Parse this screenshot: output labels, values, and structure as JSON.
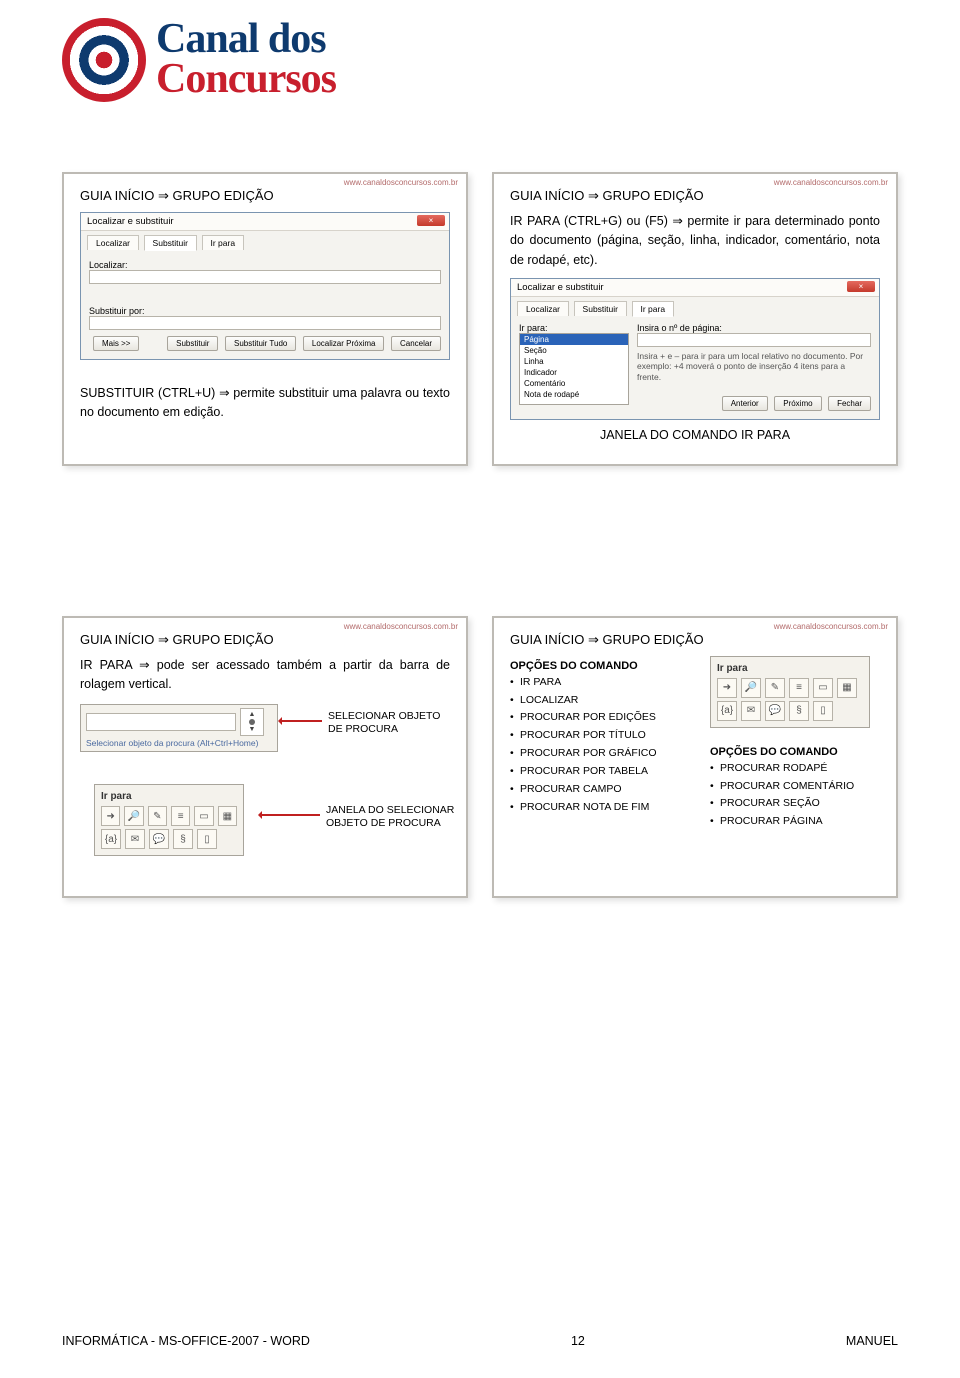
{
  "logo": {
    "line1": "Canal dos",
    "line2": "Concursos"
  },
  "watermark": "www.canaldosconcursos.com.br",
  "row1": {
    "left": {
      "title": "GUIA INÍCIO ⇒ GRUPO EDIÇÃO",
      "dialog": {
        "title": "Localizar e substituir",
        "tabs": [
          "Localizar",
          "Substituir",
          "Ir para"
        ],
        "label_find": "Localizar:",
        "label_replace": "Substituir por:",
        "buttons": [
          "Mais >>",
          "Substituir",
          "Substituir Tudo",
          "Localizar Próxima",
          "Cancelar"
        ]
      },
      "body_text": "SUBSTITUIR (CTRL+U) ⇒ permite substituir uma palavra ou texto no documento em edição."
    },
    "right": {
      "title": "GUIA INÍCIO ⇒ GRUPO EDIÇÃO",
      "body_text": "IR PARA (CTRL+G) ou (F5) ⇒ permite ir para determinado ponto do documento (página, seção, linha, indicador, comentário, nota de rodapé, etc).",
      "dialog": {
        "title": "Localizar e substituir",
        "tabs": [
          "Localizar",
          "Substituir",
          "Ir para"
        ],
        "label_goto": "Ir para:",
        "label_pagenum": "Insira o nº de página:",
        "list": [
          "Página",
          "Seção",
          "Linha",
          "Indicador",
          "Comentário",
          "Nota de rodapé"
        ],
        "note": "Insira + e – para ir para um local relativo no documento. Por exemplo: +4 moverá o ponto de inserção 4 itens para a frente.",
        "buttons": [
          "Anterior",
          "Próximo",
          "Fechar"
        ]
      },
      "caption": "JANELA DO COMANDO IR PARA"
    }
  },
  "row2": {
    "left": {
      "title": "GUIA INÍCIO ⇒ GRUPO EDIÇÃO",
      "body_text": "IR PARA ⇒ pode ser acessado também a partir da barra de rolagem vertical.",
      "chooser_label": "Selecionar objeto da procura (Alt+Ctrl+Home)",
      "toolbar_title": "Ir para",
      "cap1": "SELECIONAR OBJETO\nDE PROCURA",
      "cap2": "JANELA DO SELECIONAR\nOBJETO DE PROCURA"
    },
    "right": {
      "title": "GUIA INÍCIO ⇒ GRUPO EDIÇÃO",
      "opts_title_left": "OPÇÕES  DO COMANDO",
      "opts_left": [
        "IR PARA",
        "LOCALIZAR",
        "PROCURAR POR EDIÇÕES",
        "PROCURAR POR TÍTULO",
        "PROCURAR POR GRÁFICO",
        "PROCURAR POR TABELA",
        "PROCURAR CAMPO",
        "PROCURAR NOTA DE FIM"
      ],
      "toolbar_title": "Ir para",
      "opts_title_right": "OPÇÕES  DO COMANDO",
      "opts_right": [
        "PROCURAR RODAPÉ",
        "PROCURAR COMENTÁRIO",
        "PROCURAR SEÇÃO",
        "PROCURAR PÁGINA"
      ]
    }
  },
  "footer": {
    "left": "INFORMÁTICA - MS-OFFICE-2007 - WORD",
    "center": "12",
    "right": "MANUEL"
  }
}
